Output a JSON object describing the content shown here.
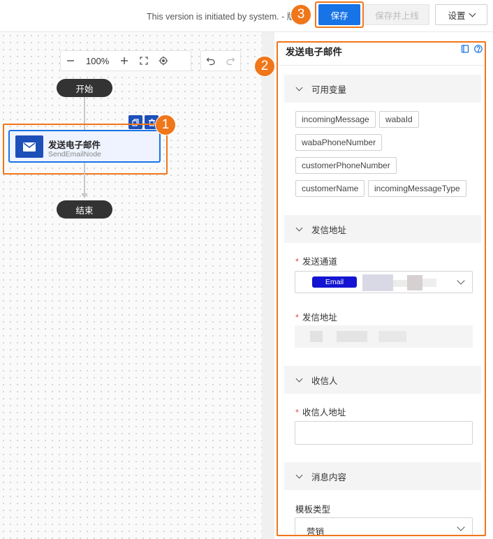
{
  "topbar": {
    "version_text": "This version is initiated by system. - 版本",
    "save_label": "保存",
    "save_publish_label": "保存并上线",
    "settings_label": "设置"
  },
  "canvas_toolbar": {
    "zoom_out_icon": "minus-icon",
    "zoom_level": "100%",
    "zoom_in_icon": "plus-icon",
    "fit_icon": "fit-screen-icon",
    "locate_icon": "target-icon",
    "undo_icon": "undo-icon",
    "redo_icon": "redo-icon"
  },
  "flow": {
    "start_label": "开始",
    "end_label": "结束",
    "node": {
      "title": "发送电子邮件",
      "subtitle": "SendEmailNode",
      "icon": "mail-icon"
    }
  },
  "badges": [
    "1",
    "2",
    "3"
  ],
  "panel": {
    "title": "发送电子邮件",
    "sections": {
      "variables": {
        "label": "可用变量",
        "tags": [
          "incomingMessage",
          "wabaId",
          "wabaPhoneNumber",
          "customerPhoneNumber",
          "customerName",
          "incomingMessageType"
        ]
      },
      "sender": {
        "label": "发信地址",
        "channel_label": "发送通道",
        "channel_chip": "Email",
        "address_label": "发信地址"
      },
      "recipient": {
        "label": "收信人",
        "address_label": "收信人地址"
      },
      "content": {
        "label": "消息内容",
        "template_type_label": "模板类型",
        "template_type_value": "营销"
      }
    }
  },
  "colors": {
    "accent": "#1773e6",
    "highlight": "#f0761a",
    "node_icon_bg": "#1d4fb8",
    "email_chip": "#1414d2"
  }
}
